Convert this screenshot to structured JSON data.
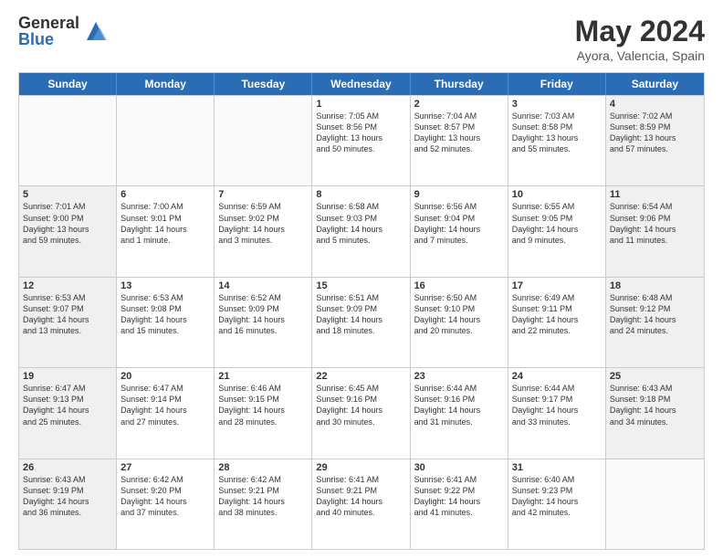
{
  "logo": {
    "general": "General",
    "blue": "Blue"
  },
  "title": {
    "month": "May 2024",
    "location": "Ayora, Valencia, Spain"
  },
  "weekdays": [
    "Sunday",
    "Monday",
    "Tuesday",
    "Wednesday",
    "Thursday",
    "Friday",
    "Saturday"
  ],
  "weeks": [
    [
      {
        "day": "",
        "info": "",
        "empty": true
      },
      {
        "day": "",
        "info": "",
        "empty": true
      },
      {
        "day": "",
        "info": "",
        "empty": true
      },
      {
        "day": "1",
        "info": "Sunrise: 7:05 AM\nSunset: 8:56 PM\nDaylight: 13 hours\nand 50 minutes.",
        "empty": false
      },
      {
        "day": "2",
        "info": "Sunrise: 7:04 AM\nSunset: 8:57 PM\nDaylight: 13 hours\nand 52 minutes.",
        "empty": false
      },
      {
        "day": "3",
        "info": "Sunrise: 7:03 AM\nSunset: 8:58 PM\nDaylight: 13 hours\nand 55 minutes.",
        "empty": false
      },
      {
        "day": "4",
        "info": "Sunrise: 7:02 AM\nSunset: 8:59 PM\nDaylight: 13 hours\nand 57 minutes.",
        "empty": false,
        "shaded": true
      }
    ],
    [
      {
        "day": "5",
        "info": "Sunrise: 7:01 AM\nSunset: 9:00 PM\nDaylight: 13 hours\nand 59 minutes.",
        "empty": false,
        "shaded": true
      },
      {
        "day": "6",
        "info": "Sunrise: 7:00 AM\nSunset: 9:01 PM\nDaylight: 14 hours\nand 1 minute.",
        "empty": false
      },
      {
        "day": "7",
        "info": "Sunrise: 6:59 AM\nSunset: 9:02 PM\nDaylight: 14 hours\nand 3 minutes.",
        "empty": false
      },
      {
        "day": "8",
        "info": "Sunrise: 6:58 AM\nSunset: 9:03 PM\nDaylight: 14 hours\nand 5 minutes.",
        "empty": false
      },
      {
        "day": "9",
        "info": "Sunrise: 6:56 AM\nSunset: 9:04 PM\nDaylight: 14 hours\nand 7 minutes.",
        "empty": false
      },
      {
        "day": "10",
        "info": "Sunrise: 6:55 AM\nSunset: 9:05 PM\nDaylight: 14 hours\nand 9 minutes.",
        "empty": false
      },
      {
        "day": "11",
        "info": "Sunrise: 6:54 AM\nSunset: 9:06 PM\nDaylight: 14 hours\nand 11 minutes.",
        "empty": false,
        "shaded": true
      }
    ],
    [
      {
        "day": "12",
        "info": "Sunrise: 6:53 AM\nSunset: 9:07 PM\nDaylight: 14 hours\nand 13 minutes.",
        "empty": false,
        "shaded": true
      },
      {
        "day": "13",
        "info": "Sunrise: 6:53 AM\nSunset: 9:08 PM\nDaylight: 14 hours\nand 15 minutes.",
        "empty": false
      },
      {
        "day": "14",
        "info": "Sunrise: 6:52 AM\nSunset: 9:09 PM\nDaylight: 14 hours\nand 16 minutes.",
        "empty": false
      },
      {
        "day": "15",
        "info": "Sunrise: 6:51 AM\nSunset: 9:09 PM\nDaylight: 14 hours\nand 18 minutes.",
        "empty": false
      },
      {
        "day": "16",
        "info": "Sunrise: 6:50 AM\nSunset: 9:10 PM\nDaylight: 14 hours\nand 20 minutes.",
        "empty": false
      },
      {
        "day": "17",
        "info": "Sunrise: 6:49 AM\nSunset: 9:11 PM\nDaylight: 14 hours\nand 22 minutes.",
        "empty": false
      },
      {
        "day": "18",
        "info": "Sunrise: 6:48 AM\nSunset: 9:12 PM\nDaylight: 14 hours\nand 24 minutes.",
        "empty": false,
        "shaded": true
      }
    ],
    [
      {
        "day": "19",
        "info": "Sunrise: 6:47 AM\nSunset: 9:13 PM\nDaylight: 14 hours\nand 25 minutes.",
        "empty": false,
        "shaded": true
      },
      {
        "day": "20",
        "info": "Sunrise: 6:47 AM\nSunset: 9:14 PM\nDaylight: 14 hours\nand 27 minutes.",
        "empty": false
      },
      {
        "day": "21",
        "info": "Sunrise: 6:46 AM\nSunset: 9:15 PM\nDaylight: 14 hours\nand 28 minutes.",
        "empty": false
      },
      {
        "day": "22",
        "info": "Sunrise: 6:45 AM\nSunset: 9:16 PM\nDaylight: 14 hours\nand 30 minutes.",
        "empty": false
      },
      {
        "day": "23",
        "info": "Sunrise: 6:44 AM\nSunset: 9:16 PM\nDaylight: 14 hours\nand 31 minutes.",
        "empty": false
      },
      {
        "day": "24",
        "info": "Sunrise: 6:44 AM\nSunset: 9:17 PM\nDaylight: 14 hours\nand 33 minutes.",
        "empty": false
      },
      {
        "day": "25",
        "info": "Sunrise: 6:43 AM\nSunset: 9:18 PM\nDaylight: 14 hours\nand 34 minutes.",
        "empty": false,
        "shaded": true
      }
    ],
    [
      {
        "day": "26",
        "info": "Sunrise: 6:43 AM\nSunset: 9:19 PM\nDaylight: 14 hours\nand 36 minutes.",
        "empty": false,
        "shaded": true
      },
      {
        "day": "27",
        "info": "Sunrise: 6:42 AM\nSunset: 9:20 PM\nDaylight: 14 hours\nand 37 minutes.",
        "empty": false
      },
      {
        "day": "28",
        "info": "Sunrise: 6:42 AM\nSunset: 9:21 PM\nDaylight: 14 hours\nand 38 minutes.",
        "empty": false
      },
      {
        "day": "29",
        "info": "Sunrise: 6:41 AM\nSunset: 9:21 PM\nDaylight: 14 hours\nand 40 minutes.",
        "empty": false
      },
      {
        "day": "30",
        "info": "Sunrise: 6:41 AM\nSunset: 9:22 PM\nDaylight: 14 hours\nand 41 minutes.",
        "empty": false
      },
      {
        "day": "31",
        "info": "Sunrise: 6:40 AM\nSunset: 9:23 PM\nDaylight: 14 hours\nand 42 minutes.",
        "empty": false
      },
      {
        "day": "",
        "info": "",
        "empty": true,
        "shaded": true
      }
    ]
  ]
}
